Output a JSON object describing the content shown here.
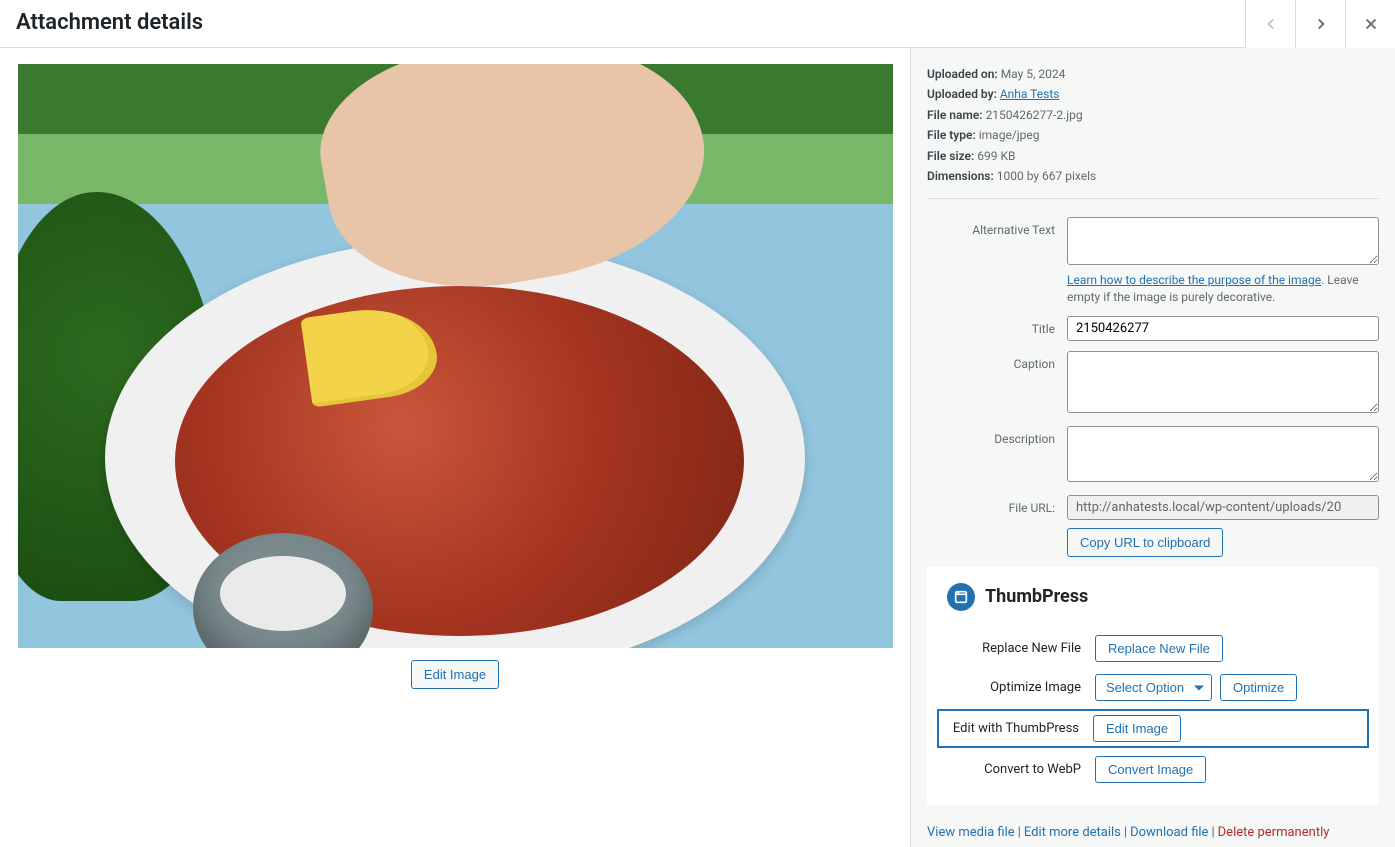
{
  "header": {
    "title": "Attachment details"
  },
  "meta": {
    "uploaded_on_label": "Uploaded on:",
    "uploaded_on": "May 5, 2024",
    "uploaded_by_label": "Uploaded by:",
    "uploaded_by": "Anha Tests",
    "file_name_label": "File name:",
    "file_name": "2150426277-2.jpg",
    "file_type_label": "File type:",
    "file_type": "image/jpeg",
    "file_size_label": "File size:",
    "file_size": "699 KB",
    "dimensions_label": "Dimensions:",
    "dimensions": "1000 by 667 pixels"
  },
  "edit_image_button": "Edit Image",
  "fields": {
    "alt_label": "Alternative Text",
    "alt_value": "",
    "alt_help_link": "Learn how to describe the purpose of the image",
    "alt_help_rest": ". Leave empty if the image is purely decorative.",
    "title_label": "Title",
    "title_value": "2150426277",
    "caption_label": "Caption",
    "caption_value": "",
    "description_label": "Description",
    "description_value": "",
    "file_url_label": "File URL:",
    "file_url_value": "http://anhatests.local/wp-content/uploads/20",
    "copy_url_button": "Copy URL to clipboard"
  },
  "thumbpress": {
    "brand": "ThumbPress",
    "replace_label": "Replace New File",
    "replace_button": "Replace New File",
    "optimize_label": "Optimize Image",
    "optimize_select": "Select Option",
    "optimize_button": "Optimize",
    "edit_label": "Edit with ThumbPress",
    "edit_button": "Edit Image",
    "convert_label": "Convert to WebP",
    "convert_button": "Convert Image"
  },
  "actions": {
    "view": "View media file",
    "edit_more": "Edit more details",
    "download": "Download file",
    "delete": "Delete permanently"
  }
}
